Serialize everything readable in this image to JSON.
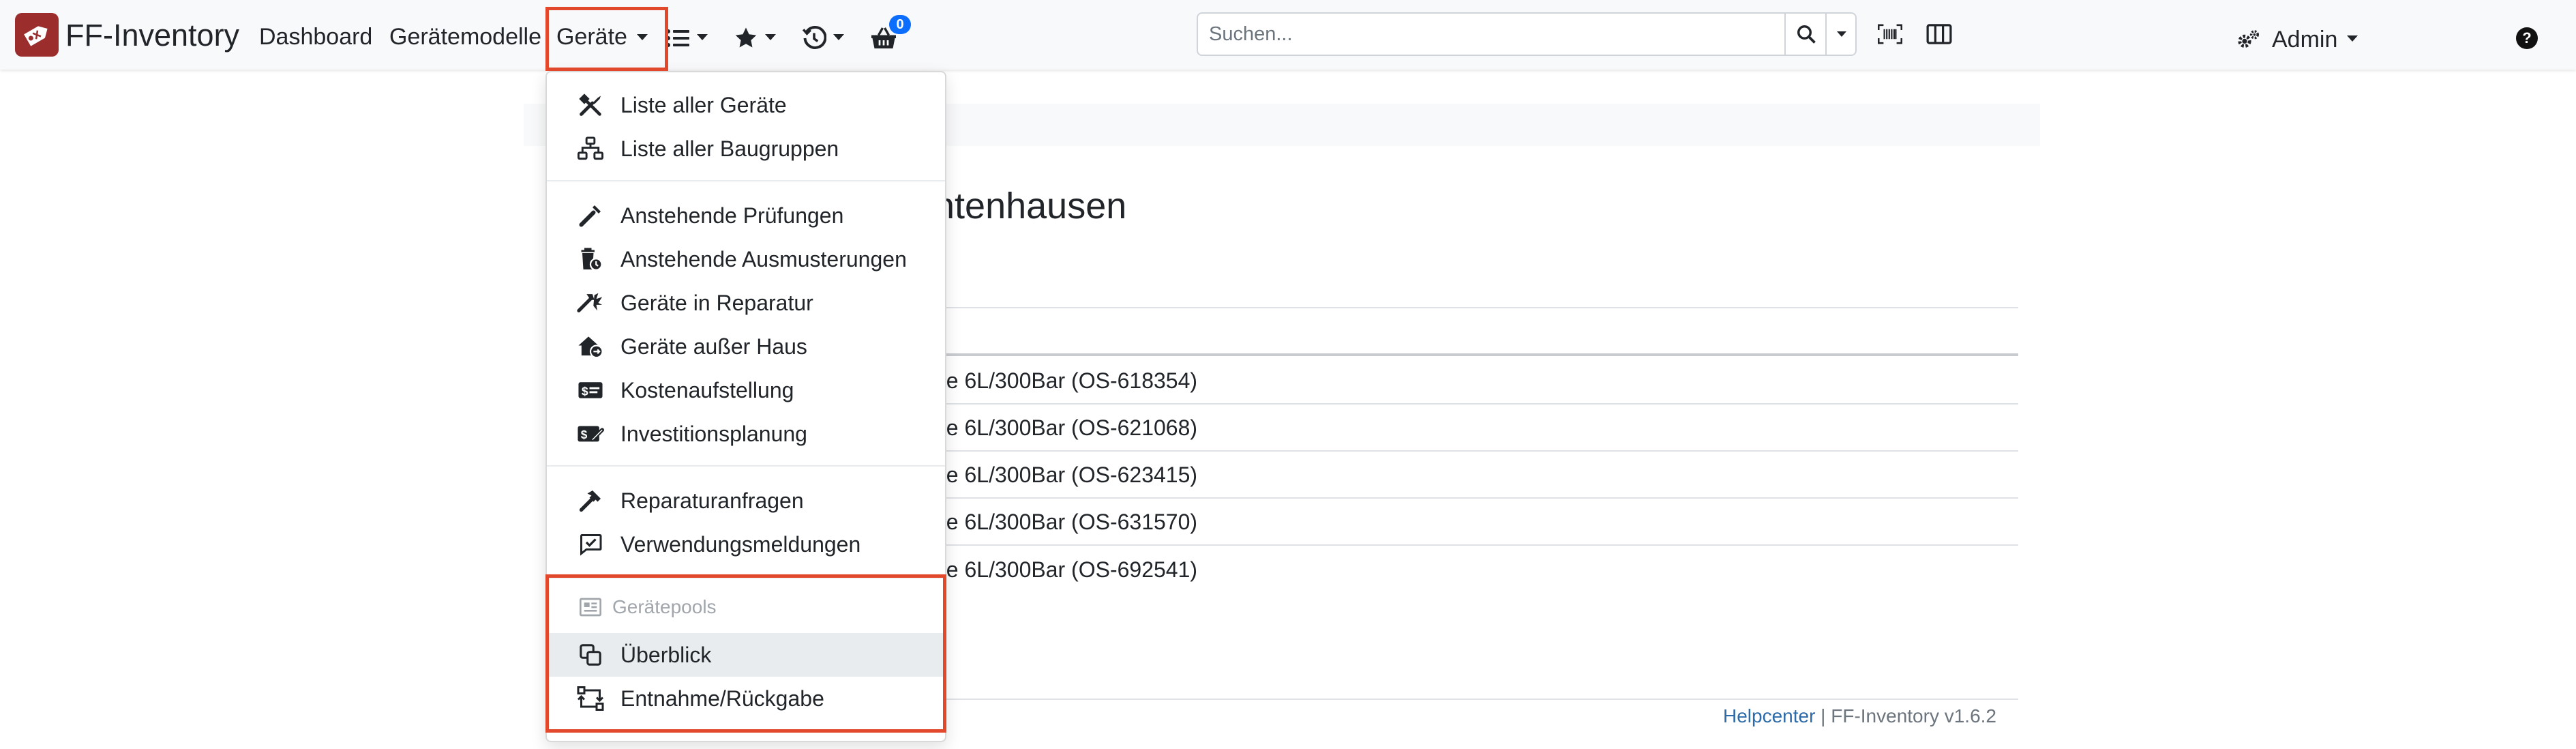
{
  "navbar": {
    "brand": "FF-Inventory",
    "links": [
      "Dashboard",
      "Gerätemodelle"
    ],
    "active_dropdown": "Geräte",
    "icons": [
      "list-icon",
      "star-icon",
      "history-icon",
      "basket-icon"
    ],
    "basket_count": "0",
    "search_placeholder": "Suchen...",
    "user": "Admin",
    "help": "?"
  },
  "page": {
    "title_fragment": "ntenhausen",
    "rows": [
      "ne 6L/300Bar (OS-618354)",
      "ne 6L/300Bar (OS-621068)",
      "ne 6L/300Bar (OS-623415)",
      "ne 6L/300Bar (OS-631570)",
      "ne 6L/300Bar (OS-692541)"
    ],
    "footer_link": "Helpcenter",
    "footer_text": " | FF-Inventory v1.6.2"
  },
  "dropdown": {
    "items": [
      {
        "label": "Liste aller Geräte",
        "icon": "tools-icon"
      },
      {
        "label": "Liste aller Baugruppen",
        "icon": "sitemap-icon"
      },
      {
        "label": "Anstehende Prüfungen",
        "icon": "wand-icon"
      },
      {
        "label": "Anstehende Ausmusterungen",
        "icon": "trash-clock-icon"
      },
      {
        "label": "Geräte in Reparatur",
        "icon": "repair-icon"
      },
      {
        "label": "Geräte außer Haus",
        "icon": "house-out-icon"
      },
      {
        "label": "Kostenaufstellung",
        "icon": "money-card-icon"
      },
      {
        "label": "Investitionsplanung",
        "icon": "money-edit-icon"
      },
      {
        "label": "Reparaturanfragen",
        "icon": "hammer-icon"
      },
      {
        "label": "Verwendungsmeldungen",
        "icon": "message-check-icon"
      }
    ],
    "pool_header": "Gerätepools",
    "pool_items": [
      {
        "label": "Überblick",
        "icon": "copy-icon"
      },
      {
        "label": "Entnahme/Rückgabe",
        "icon": "transfer-icon"
      }
    ]
  },
  "colors": {
    "highlight": "#e2482b",
    "brand": "#9b2d2d",
    "badge": "#0d6efd",
    "link": "#2c6aa8"
  }
}
